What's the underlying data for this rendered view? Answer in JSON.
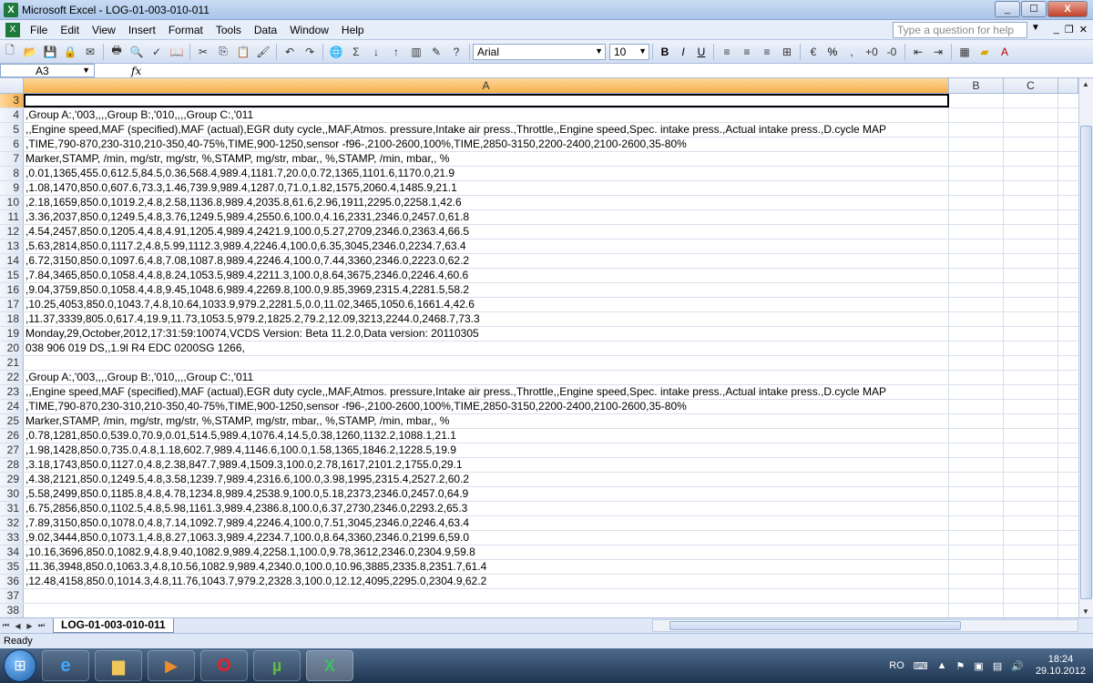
{
  "window": {
    "title": "Microsoft Excel - LOG-01-003-010-011",
    "controls": [
      "_",
      "☐",
      "X"
    ]
  },
  "menu": {
    "items": [
      "File",
      "Edit",
      "View",
      "Insert",
      "Format",
      "Tools",
      "Data",
      "Window",
      "Help"
    ],
    "ask_placeholder": "Type a question for help"
  },
  "toolbar": {
    "font": "Arial",
    "size": "10",
    "bold": "B",
    "italic": "I",
    "underline": "U",
    "percent": "%"
  },
  "formula_bar": {
    "cell_ref": "A3",
    "fx": "fx",
    "content": ""
  },
  "columns": [
    "A",
    "B",
    "C"
  ],
  "rows": [
    {
      "n": "3",
      "a": ""
    },
    {
      "n": "4",
      "a": ",Group A:,'003,,,,Group B:,'010,,,,Group C:,'011"
    },
    {
      "n": "5",
      "a": ",,Engine speed,MAF (specified),MAF (actual),EGR duty cycle,,MAF,Atmos. pressure,Intake air press.,Throttle,,Engine speed,Spec. intake press.,Actual intake press.,D.cycle MAP"
    },
    {
      "n": "6",
      "a": ",TIME,790-870,230-310,210-350,40-75%,TIME,900-1250,sensor -f96-,2100-2600,100%,TIME,2850-3150,2200-2400,2100-2600,35-80%"
    },
    {
      "n": "7",
      "a": "Marker,STAMP, /min, mg/str, mg/str, %,STAMP, mg/str, mbar,, %,STAMP, /min, mbar,, %"
    },
    {
      "n": "8",
      "a": ",0.01,1365,455.0,612.5,84.5,0.36,568.4,989.4,1181.7,20.0,0.72,1365,1101.6,1170.0,21.9"
    },
    {
      "n": "9",
      "a": ",1.08,1470,850.0,607.6,73.3,1.46,739.9,989.4,1287.0,71.0,1.82,1575,2060.4,1485.9,21.1"
    },
    {
      "n": "10",
      "a": ",2.18,1659,850.0,1019.2,4.8,2.58,1136.8,989.4,2035.8,61.6,2.96,1911,2295.0,2258.1,42.6"
    },
    {
      "n": "11",
      "a": ",3.36,2037,850.0,1249.5,4.8,3.76,1249.5,989.4,2550.6,100.0,4.16,2331,2346.0,2457.0,61.8"
    },
    {
      "n": "12",
      "a": ",4.54,2457,850.0,1205.4,4.8,4.91,1205.4,989.4,2421.9,100.0,5.27,2709,2346.0,2363.4,66.5"
    },
    {
      "n": "13",
      "a": ",5.63,2814,850.0,1117.2,4.8,5.99,1112.3,989.4,2246.4,100.0,6.35,3045,2346.0,2234.7,63.4"
    },
    {
      "n": "14",
      "a": ",6.72,3150,850.0,1097.6,4.8,7.08,1087.8,989.4,2246.4,100.0,7.44,3360,2346.0,2223.0,62.2"
    },
    {
      "n": "15",
      "a": ",7.84,3465,850.0,1058.4,4.8,8.24,1053.5,989.4,2211.3,100.0,8.64,3675,2346.0,2246.4,60.6"
    },
    {
      "n": "16",
      "a": ",9.04,3759,850.0,1058.4,4.8,9.45,1048.6,989.4,2269.8,100.0,9.85,3969,2315.4,2281.5,58.2"
    },
    {
      "n": "17",
      "a": ",10.25,4053,850.0,1043.7,4.8,10.64,1033.9,979.2,2281.5,0.0,11.02,3465,1050.6,1661.4,42.6"
    },
    {
      "n": "18",
      "a": ",11.37,3339,805.0,617.4,19.9,11.73,1053.5,979.2,1825.2,79.2,12.09,3213,2244.0,2468.7,73.3"
    },
    {
      "n": "19",
      "a": "Monday,29,October,2012,17:31:59:10074,VCDS Version: Beta 11.2.0,Data version: 20110305"
    },
    {
      "n": "20",
      "a": "038 906 019 DS,,1.9l R4 EDC 0200SG  1266,"
    },
    {
      "n": "21",
      "a": ""
    },
    {
      "n": "22",
      "a": ",Group A:,'003,,,,Group B:,'010,,,,Group C:,'011"
    },
    {
      "n": "23",
      "a": ",,Engine speed,MAF (specified),MAF (actual),EGR duty cycle,,MAF,Atmos. pressure,Intake air press.,Throttle,,Engine speed,Spec. intake press.,Actual intake press.,D.cycle MAP"
    },
    {
      "n": "24",
      "a": ",TIME,790-870,230-310,210-350,40-75%,TIME,900-1250,sensor -f96-,2100-2600,100%,TIME,2850-3150,2200-2400,2100-2600,35-80%"
    },
    {
      "n": "25",
      "a": "Marker,STAMP, /min, mg/str, mg/str, %,STAMP, mg/str, mbar,, %,STAMP, /min, mbar,, %"
    },
    {
      "n": "26",
      "a": ",0.78,1281,850.0,539.0,70.9,0.01,514.5,989.4,1076.4,14.5,0.38,1260,1132.2,1088.1,21.1"
    },
    {
      "n": "27",
      "a": ",1.98,1428,850.0,735.0,4.8,1.18,602.7,989.4,1146.6,100.0,1.58,1365,1846.2,1228.5,19.9"
    },
    {
      "n": "28",
      "a": ",3.18,1743,850.0,1127.0,4.8,2.38,847.7,989.4,1509.3,100.0,2.78,1617,2101.2,1755.0,29.1"
    },
    {
      "n": "29",
      "a": ",4.38,2121,850.0,1249.5,4.8,3.58,1239.7,989.4,2316.6,100.0,3.98,1995,2315.4,2527.2,60.2"
    },
    {
      "n": "30",
      "a": ",5.58,2499,850.0,1185.8,4.8,4.78,1234.8,989.4,2538.9,100.0,5.18,2373,2346.0,2457.0,64.9"
    },
    {
      "n": "31",
      "a": ",6.75,2856,850.0,1102.5,4.8,5.98,1161.3,989.4,2386.8,100.0,6.37,2730,2346.0,2293.2,65.3"
    },
    {
      "n": "32",
      "a": ",7.89,3150,850.0,1078.0,4.8,7.14,1092.7,989.4,2246.4,100.0,7.51,3045,2346.0,2246.4,63.4"
    },
    {
      "n": "33",
      "a": ",9.02,3444,850.0,1073.1,4.8,8.27,1063.3,989.4,2234.7,100.0,8.64,3360,2346.0,2199.6,59.0"
    },
    {
      "n": "34",
      "a": ",10.16,3696,850.0,1082.9,4.8,9.40,1082.9,989.4,2258.1,100.0,9.78,3612,2346.0,2304.9,59.8"
    },
    {
      "n": "35",
      "a": ",11.36,3948,850.0,1063.3,4.8,10.56,1082.9,989.4,2340.0,100.0,10.96,3885,2335.8,2351.7,61.4"
    },
    {
      "n": "36",
      "a": ",12.48,4158,850.0,1014.3,4.8,11.76,1043.7,979.2,2328.3,100.0,12.12,4095,2295.0,2304.9,62.2"
    },
    {
      "n": "37",
      "a": ""
    },
    {
      "n": "38",
      "a": ""
    }
  ],
  "sheet_tab": "LOG-01-003-010-011",
  "status": "Ready",
  "taskbar": {
    "lang": "RO",
    "time": "18:24",
    "date": "29.10.2012"
  },
  "colors": {
    "active_header": "#f5b04a",
    "title_bg": "#aac5ea"
  }
}
